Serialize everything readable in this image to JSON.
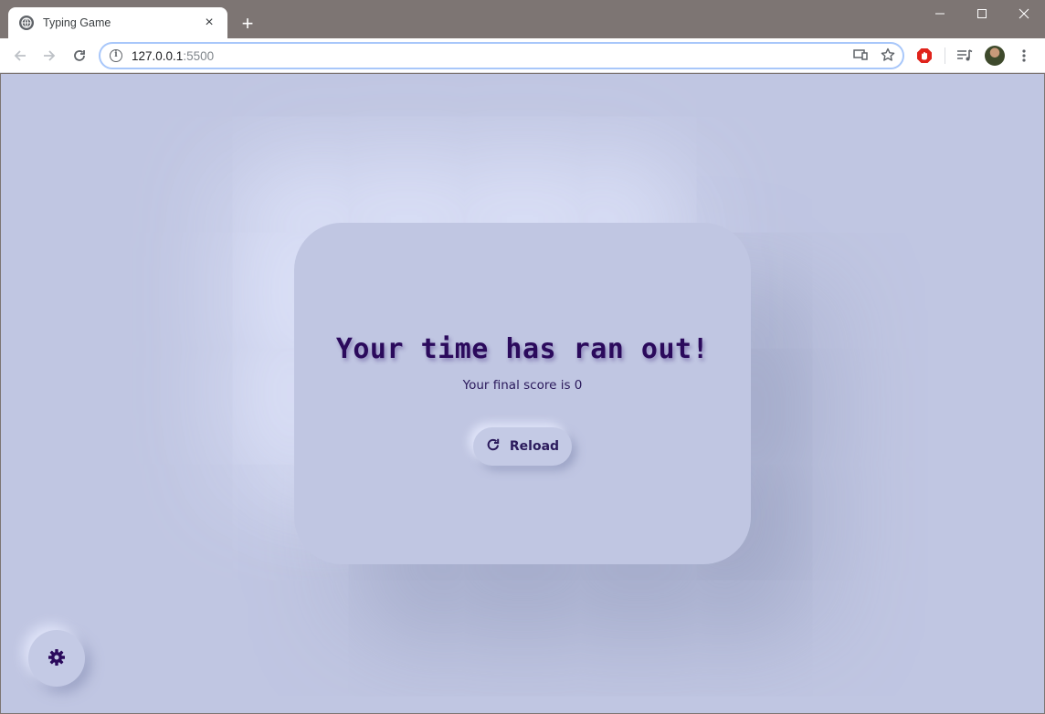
{
  "browser": {
    "tab_title": "Typing Game",
    "tab_close": "×",
    "new_tab": "+",
    "url_host": "127.0.0.1",
    "url_port": ":5500"
  },
  "game_over": {
    "heading": "Your time has ran out!",
    "score_text": "Your final score is 0",
    "reload_label": "Reload"
  },
  "colors": {
    "page_background": "#c0c6e2",
    "text_primary": "#2b0a5c",
    "chrome_frame": "#7d7573"
  }
}
